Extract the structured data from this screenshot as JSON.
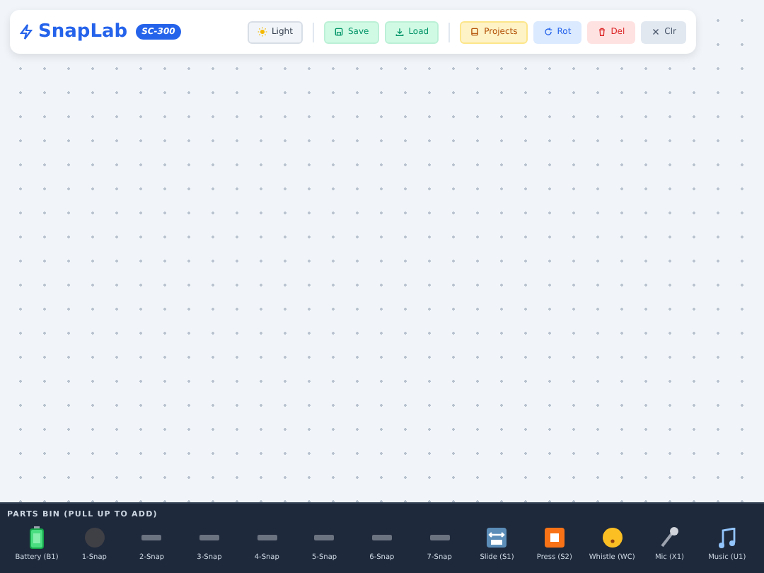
{
  "header": {
    "title": "SnapLab",
    "badge": "SC-300"
  },
  "toolbar": [
    {
      "label": "Light",
      "kind": "theme"
    },
    {
      "label": "Save",
      "kind": "save"
    },
    {
      "label": "Load",
      "kind": "load"
    },
    {
      "label": "Projects",
      "kind": "projects"
    },
    {
      "label": "Rot",
      "kind": "rotate"
    },
    {
      "label": "Del",
      "kind": "delete"
    },
    {
      "label": "Clr",
      "kind": "clear"
    }
  ],
  "parts_bin": {
    "title": "PARTS BIN (PULL UP TO ADD)",
    "parts": [
      {
        "label": "Battery (B1)",
        "kind": "battery"
      },
      {
        "label": "1-Snap",
        "kind": "snap"
      },
      {
        "label": "2-Snap",
        "kind": "wire"
      },
      {
        "label": "3-Snap",
        "kind": "wire"
      },
      {
        "label": "4-Snap",
        "kind": "wire"
      },
      {
        "label": "5-Snap",
        "kind": "wire"
      },
      {
        "label": "6-Snap",
        "kind": "wire"
      },
      {
        "label": "7-Snap",
        "kind": "wire"
      },
      {
        "label": "Slide (S1)",
        "kind": "slide"
      },
      {
        "label": "Press (S2)",
        "kind": "press"
      },
      {
        "label": "Whistle (WC)",
        "kind": "whistle"
      },
      {
        "label": "Mic (X1)",
        "kind": "mic"
      },
      {
        "label": "Music (U1)",
        "kind": "music"
      }
    ]
  }
}
